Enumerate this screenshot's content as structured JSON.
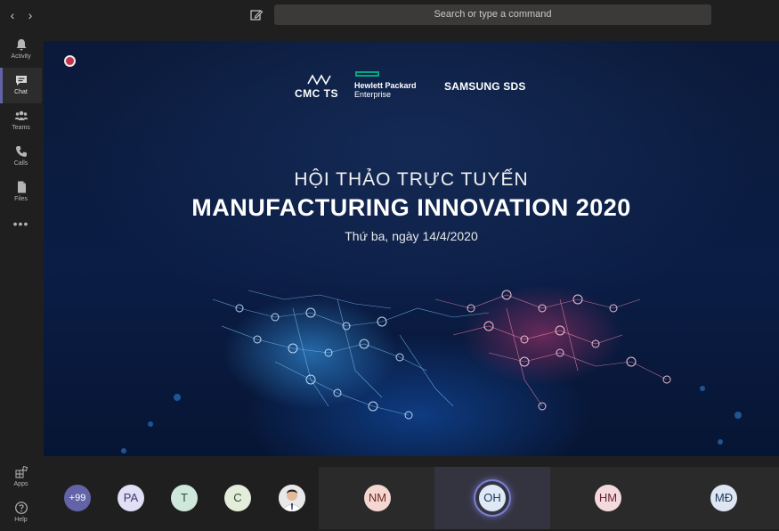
{
  "topbar": {
    "back_icon": "chevron-left-icon",
    "forward_icon": "chevron-right-icon",
    "compose_icon": "compose-icon",
    "search_placeholder": "Search or type a command"
  },
  "rail": {
    "items": [
      {
        "label": "Activity",
        "icon": "bell-icon"
      },
      {
        "label": "Chat",
        "icon": "chat-icon",
        "active": true
      },
      {
        "label": "Teams",
        "icon": "teams-icon"
      },
      {
        "label": "Calls",
        "icon": "phone-icon"
      },
      {
        "label": "Files",
        "icon": "file-icon"
      }
    ],
    "more": "•••",
    "bottom": [
      {
        "label": "Apps",
        "icon": "apps-icon"
      },
      {
        "label": "Help",
        "icon": "help-icon"
      }
    ]
  },
  "slide": {
    "logos": {
      "cmc": "CMC TS",
      "hpe_line1": "Hewlett Packard",
      "hpe_line2": "Enterprise",
      "samsung": "SAMSUNG SDS"
    },
    "title_line1": "HỘI THẢO TRỰC TUYẾN",
    "title_line2": "MANUFACTURING INNOVATION 2020",
    "date_line": "Thứ ba, ngày 14/4/2020"
  },
  "participants": [
    {
      "initials": "+99",
      "bg": "#6264a7",
      "fg": "#ffffff"
    },
    {
      "initials": "PA",
      "bg": "#e0dff5",
      "fg": "#3b3a6a"
    },
    {
      "initials": "T",
      "bg": "#cfe8dc",
      "fg": "#2b4d3a"
    },
    {
      "initials": "C",
      "bg": "#e4ecdc",
      "fg": "#3a4a2a"
    },
    {
      "initials": "",
      "photo": true
    },
    {
      "initials": "NM",
      "bg": "#f5d7d2",
      "fg": "#6b2b22"
    },
    {
      "initials": "OH",
      "bg": "#dfe9f5",
      "fg": "#203a5a",
      "speaking": true
    },
    {
      "initials": "HM",
      "bg": "#f3d9de",
      "fg": "#6b2234"
    },
    {
      "initials": "MĐ",
      "bg": "#dde6f2",
      "fg": "#203a5a"
    }
  ]
}
